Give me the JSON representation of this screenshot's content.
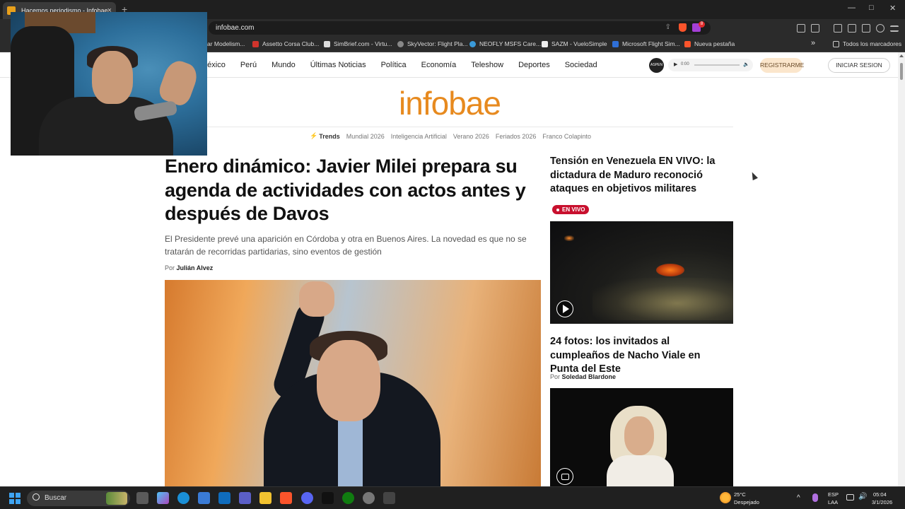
{
  "browser": {
    "tab_title": "Hacemos periodismo - Infobae",
    "tab_close": "×",
    "new_tab": "+",
    "url": "infobae.com",
    "rewards_badge": "8",
    "window": {
      "minimize": "—",
      "maximize": "□",
      "close": "✕"
    }
  },
  "bookmarks": {
    "items": [
      {
        "label": "ar Modelism...",
        "icon_color": "#444444"
      },
      {
        "label": "Assetto Corsa Club...",
        "icon_color": "#d0342c"
      },
      {
        "label": "SimBrief.com - Virtu...",
        "icon_color": "#dddddd"
      },
      {
        "label": "SkyVector: Flight Pla...",
        "icon_color": "#888888"
      },
      {
        "label": "NEOFLY MSFS Care...",
        "icon_color": "#3a9ad9"
      },
      {
        "label": "SAZM - VueloSimple",
        "icon_color": "#222222"
      },
      {
        "label": "Microsoft Flight Sim...",
        "icon_color": "#2f6fd6"
      },
      {
        "label": "Nueva pestaña",
        "icon_color": "#fb542b"
      }
    ],
    "more": "»",
    "all_label": "Todos los marcadores"
  },
  "nav": {
    "links": [
      "México",
      "Perú",
      "Mundo",
      "Últimas Noticias",
      "Política",
      "Economía",
      "Teleshow",
      "Deportes",
      "Sociedad"
    ],
    "aspen": "ASPEN",
    "player": {
      "play": "▶",
      "time": "0:00",
      "volume": "🔈"
    },
    "register": "REGISTRARME",
    "login": "INICIAR SESION"
  },
  "logo": "infobae",
  "trends": {
    "label": "Trends",
    "items": [
      "Mundial 2026",
      "Inteligencia Artificial",
      "Verano 2026",
      "Feriados 2026",
      "Franco Colapinto"
    ]
  },
  "main_story": {
    "headline": "Enero dinámico: Javier Milei prepara su agenda de actividades con actos antes y después de Davos",
    "deck": "El Presidente prevé una aparición en Córdoba y otra en Buenos Aires. La novedad es que no se tratarán de recorridas partidarias, sino eventos de gestión",
    "by_prefix": "Por",
    "author": "Julián Alvez"
  },
  "side_story_1": {
    "title": "Tensión en Venezuela EN VIVO: la dictadura de Maduro reconoció ataques en objetivos militares",
    "live_label": "EN VIVO"
  },
  "side_story_2": {
    "title": "24 fotos: los invitados al cumpleaños de Nacho Viale en Punta del Este",
    "by_prefix": "Por",
    "author": "Soledad Blardone"
  },
  "taskbar": {
    "search_label": "Buscar",
    "weather_temp": "25°C",
    "weather_desc": "Despejado",
    "lang_1": "ESP",
    "lang_2": "LAA",
    "time": "05:04",
    "date": "3/1/2026",
    "chevron": "^"
  },
  "colors": {
    "brand": "#e78a1f",
    "live": "#c8102e"
  }
}
